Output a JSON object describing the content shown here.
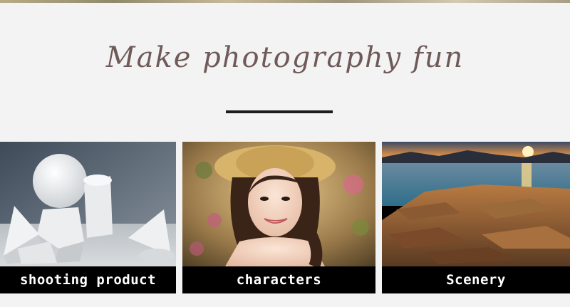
{
  "headline": "Make photography fun",
  "cards": [
    {
      "caption": "shooting product",
      "image": "white-geometric-plaster-shapes"
    },
    {
      "caption": "characters",
      "image": "portrait-woman-straw-hat"
    },
    {
      "caption": "Scenery",
      "image": "sunset-over-rocky-shore"
    }
  ],
  "colors": {
    "background": "#f3f3f3",
    "headline": "#6e5a58",
    "caption_bar": "#000000",
    "caption_text": "#ffffff"
  }
}
